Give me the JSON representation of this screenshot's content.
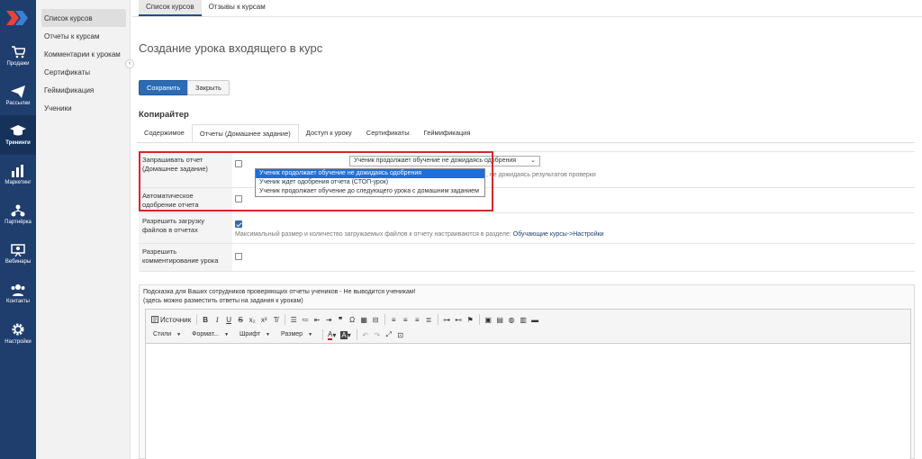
{
  "rail": {
    "items": [
      {
        "label": "Продажи",
        "icon": "cart-icon"
      },
      {
        "label": "Рассылки",
        "icon": "paper-plane-icon"
      },
      {
        "label": "Тренинги",
        "icon": "graduation-cap-icon",
        "active": true
      },
      {
        "label": "Маркетинг",
        "icon": "bar-chart-icon"
      },
      {
        "label": "Партнёрка",
        "icon": "network-icon"
      },
      {
        "label": "Вебинары",
        "icon": "presentation-icon"
      },
      {
        "label": "Контакты",
        "icon": "users-icon"
      },
      {
        "label": "Настройки",
        "icon": "gear-icon"
      }
    ]
  },
  "subnav": {
    "items": [
      "Список курсов",
      "Отчеты к курсам",
      "Комментарии к урокам",
      "Сертификаты",
      "Геймификация",
      "Ученики"
    ]
  },
  "toptabs": [
    "Список курсов",
    "Отзывы к курсам"
  ],
  "page": {
    "title": "Создание урока входящего в курс",
    "save_label": "Сохранить",
    "close_label": "Закрыть",
    "section_title": "Копирайтер"
  },
  "tabs": [
    "Содержимое",
    "Отчеты (Домашнее задание)",
    "Доступ к уроку",
    "Сертификаты",
    "Геймификация"
  ],
  "form": {
    "report_label": "Запрашивать отчет (Домашнее задание)",
    "report_select_value": "Ученик продолжает обучение не дожидаясь одобрения",
    "report_options": [
      "Ученик продолжает обучение не дожидаясь одобрения",
      "Ученик ждет одобрения отчета (СТОП-урок)",
      "Ученик продолжает обучение до следующего урока с домашним заданием"
    ],
    "report_hint_tail": ", не дожидаясь результатов проверки",
    "auto_approve_label": "Автоматическое одобрение отчета",
    "files_label": "Разрешить загрузку файлов в отчетах",
    "files_hint": "Максимальный размер и количество загружаемых файлов к отчету настраиваются в разделе:",
    "files_hint_link": "Обучающие курсы->Настройки",
    "comments_label": "Разрешить комментирование урока"
  },
  "editor": {
    "label_line1": "Подсказка для Ваших сотрудников проверяющих отчеты учеников - Не выводится ученикам!",
    "label_line2": "(здесь можно разместить ответы на задания к урокам)",
    "source_label": "Источник",
    "styles_label": "Стили",
    "format_label": "Формат...",
    "font_label": "Шрифт",
    "size_label": "Размер"
  },
  "colors": {
    "rail_bg": "#1f3e6e",
    "accent": "#2d6bb5",
    "highlight": "#d9262b",
    "option_selected": "#1e6fd9"
  }
}
